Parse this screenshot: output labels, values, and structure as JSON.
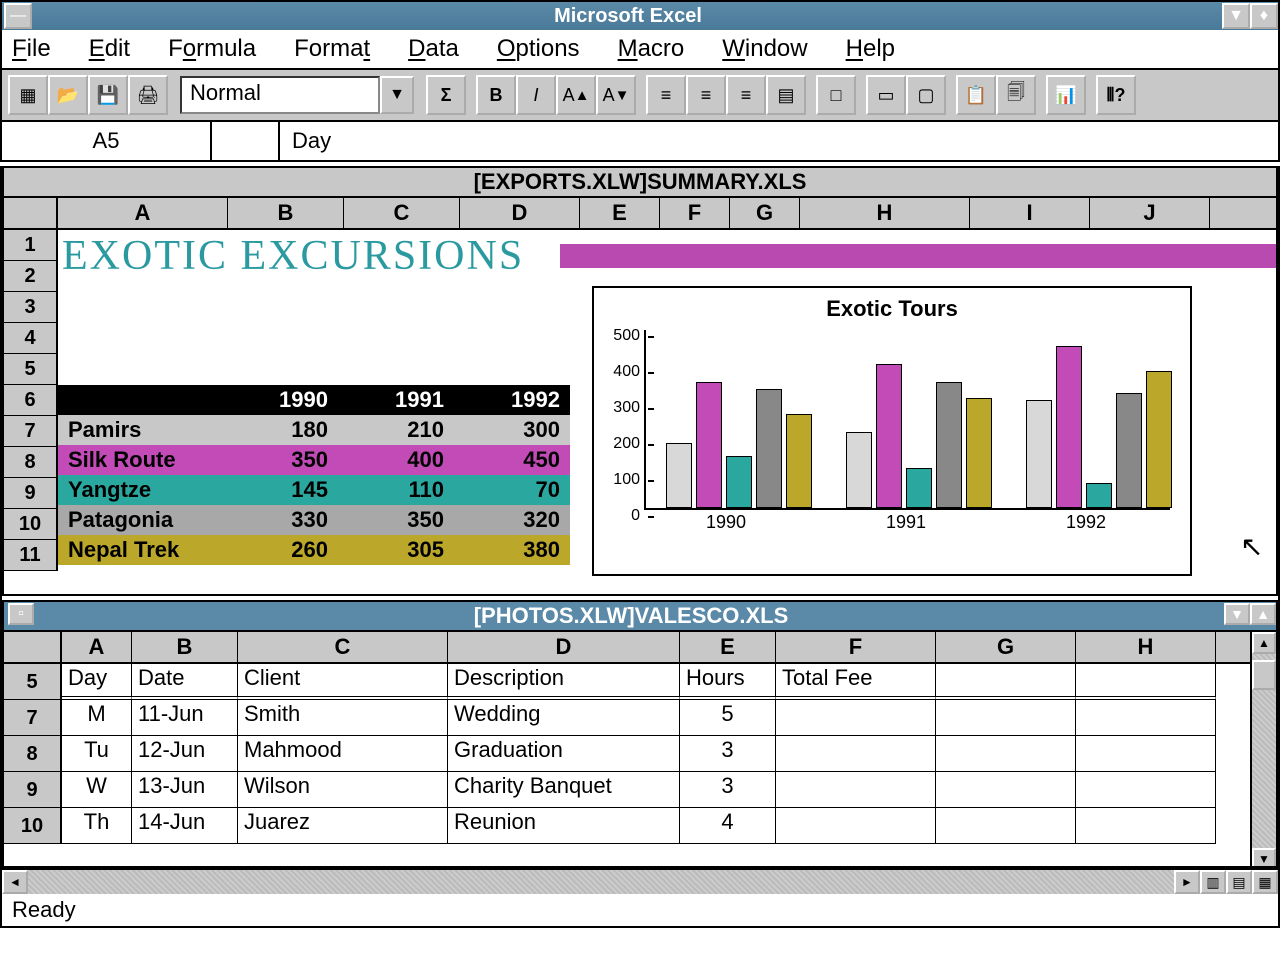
{
  "app": {
    "title": "Microsoft Excel"
  },
  "menu": {
    "items": [
      "File",
      "Edit",
      "Formula",
      "Format",
      "Data",
      "Options",
      "Macro",
      "Window",
      "Help"
    ]
  },
  "toolbar": {
    "style": "Normal"
  },
  "formula_bar": {
    "cell_ref": "A5",
    "content": "Day"
  },
  "window1": {
    "title": "[EXPORTS.XLW]SUMMARY.XLS",
    "columns": [
      "A",
      "B",
      "C",
      "D",
      "E",
      "F",
      "G",
      "H",
      "I",
      "J"
    ],
    "rows": [
      "1",
      "2",
      "3",
      "4",
      "5",
      "6",
      "7",
      "8",
      "9",
      "10",
      "11"
    ],
    "heading": "EXOTIC EXCURSIONS",
    "table": {
      "years": [
        "1990",
        "1991",
        "1992"
      ],
      "rows": [
        {
          "name": "Pamirs",
          "vals": [
            "180",
            "210",
            "300"
          ],
          "cls": "r-pamirs"
        },
        {
          "name": "Silk Route",
          "vals": [
            "350",
            "400",
            "450"
          ],
          "cls": "r-silk"
        },
        {
          "name": "Yangtze",
          "vals": [
            "145",
            "110",
            "70"
          ],
          "cls": "r-yangtze"
        },
        {
          "name": "Patagonia",
          "vals": [
            "330",
            "350",
            "320"
          ],
          "cls": "r-patagonia"
        },
        {
          "name": "Nepal Trek",
          "vals": [
            "260",
            "305",
            "380"
          ],
          "cls": "r-nepal"
        }
      ]
    },
    "chart": {
      "title": "Exotic Tours"
    }
  },
  "window2": {
    "title": "[PHOTOS.XLW]VALESCO.XLS",
    "columns": [
      "A",
      "B",
      "C",
      "D",
      "E",
      "F",
      "G",
      "H"
    ],
    "row_nums": [
      "5",
      "7",
      "8",
      "9",
      "10"
    ],
    "headers": [
      "Day",
      "Date",
      "Client",
      "Description",
      "Hours",
      "Total Fee"
    ],
    "rows": [
      [
        "M",
        "11-Jun",
        "Smith",
        "Wedding",
        "5",
        ""
      ],
      [
        "Tu",
        "12-Jun",
        "Mahmood",
        "Graduation",
        "3",
        ""
      ],
      [
        "W",
        "13-Jun",
        "Wilson",
        "Charity Banquet",
        "3",
        ""
      ],
      [
        "Th",
        "14-Jun",
        "Juarez",
        "Reunion",
        "4",
        ""
      ]
    ]
  },
  "status": {
    "text": "Ready"
  },
  "chart_data": {
    "type": "bar",
    "title": "Exotic Tours",
    "categories": [
      "1990",
      "1991",
      "1992"
    ],
    "series": [
      {
        "name": "Pamirs",
        "values": [
          180,
          210,
          300
        ]
      },
      {
        "name": "Silk Route",
        "values": [
          350,
          400,
          450
        ]
      },
      {
        "name": "Yangtze",
        "values": [
          145,
          110,
          70
        ]
      },
      {
        "name": "Patagonia",
        "values": [
          330,
          350,
          320
        ]
      },
      {
        "name": "Nepal Trek",
        "values": [
          260,
          305,
          380
        ]
      }
    ],
    "ylim": [
      0,
      500
    ],
    "yticks": [
      0,
      100,
      200,
      300,
      400,
      500
    ]
  }
}
